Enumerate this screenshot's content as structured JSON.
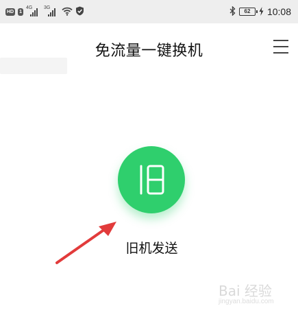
{
  "status_bar": {
    "chip_hd": "HD",
    "chip_sim": "1",
    "sim1_net": "4G",
    "sim2_net": "3G",
    "battery": "62",
    "time": "10:08"
  },
  "header": {
    "title": "免流量一键换机",
    "menu_icon": "hamburger-menu-icon"
  },
  "main": {
    "old_device_button": {
      "icon": "old-phone-glyph-icon",
      "label": "旧机发送",
      "color": "#2fcf6d"
    }
  },
  "annotation": {
    "arrow_color": "#e23b3b"
  },
  "watermark": {
    "logo": "Bai 经验",
    "url": "jingyan.baidu.com"
  }
}
